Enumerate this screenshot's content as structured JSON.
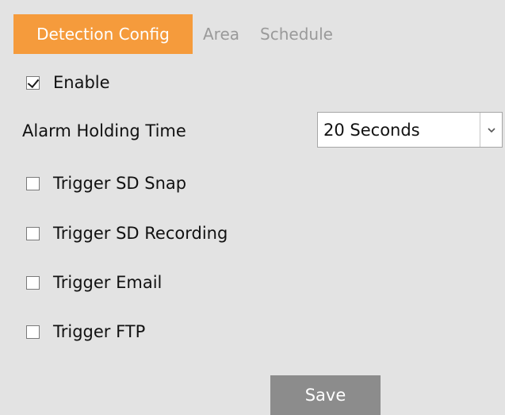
{
  "tabs": {
    "detection_config": "Detection Config",
    "area": "Area",
    "schedule": "Schedule",
    "active": "Detection Config"
  },
  "enable": {
    "label": "Enable",
    "checked": true
  },
  "alarm_holding_time": {
    "label": "Alarm Holding Time",
    "selected": "20 Seconds"
  },
  "triggers": {
    "sd_snap": {
      "label": "Trigger SD Snap",
      "checked": false
    },
    "sd_recording": {
      "label": "Trigger SD Recording",
      "checked": false
    },
    "email": {
      "label": "Trigger Email",
      "checked": false
    },
    "ftp": {
      "label": "Trigger FTP",
      "checked": false
    }
  },
  "save_label": "Save",
  "colors": {
    "accent": "#f59b3c",
    "background": "#e3e3e3",
    "save_button": "#8c8c8c",
    "inactive_tab_text": "#9a9a9a"
  },
  "icons": {
    "dropdown": "chevron-down-icon",
    "check": "checkmark-icon"
  }
}
